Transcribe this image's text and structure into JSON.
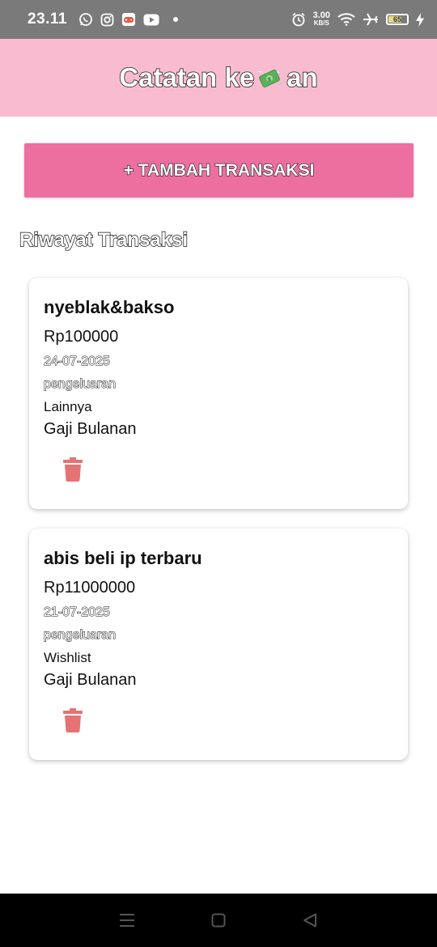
{
  "status_bar": {
    "time": "23.11",
    "net_speed_value": "3.00",
    "net_speed_unit": "KB/S",
    "battery": "65",
    "icons_left": [
      "whatsapp-icon",
      "instagram-icon",
      "game-icon",
      "youtube-icon",
      "dot"
    ],
    "icons_right": [
      "alarm-icon",
      "wifi-icon",
      "airplane-icon",
      "battery-icon",
      "charging-icon"
    ]
  },
  "header": {
    "title_before": "Catatan ke",
    "title_after": "an",
    "title_icon": "money-with-wings-icon",
    "background": "#f8bbd0"
  },
  "add_button": {
    "label": "+ TAMBAH TRANSAKSI",
    "color": "#ec6fa0"
  },
  "history": {
    "title": "Riwayat Transaksi",
    "transactions": [
      {
        "title": "nyeblak&bakso",
        "amount": "Rp100000",
        "date": "24-07-2025",
        "type": "pengeluaran",
        "category": "Lainnya",
        "source": "Gaji Bulanan"
      },
      {
        "title": "abis beli ip terbaru",
        "amount": "Rp11000000",
        "date": "21-07-2025",
        "type": "pengeluaran",
        "category": "Wishlist",
        "source": "Gaji Bulanan"
      }
    ],
    "delete_color": "#e57373"
  },
  "nav_bar": {
    "buttons": [
      "menu-icon",
      "home-icon",
      "back-icon"
    ]
  }
}
